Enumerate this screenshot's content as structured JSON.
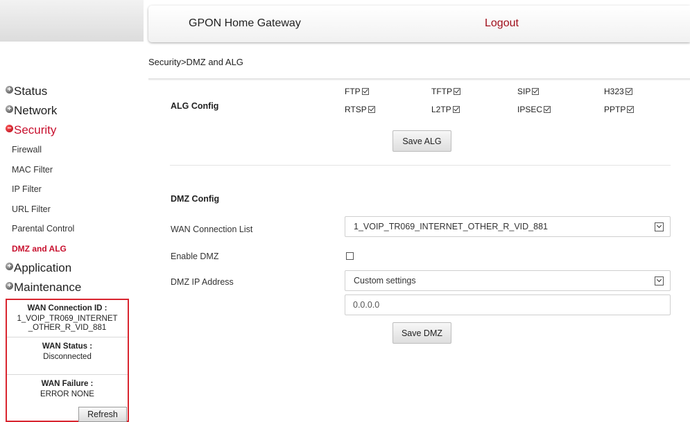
{
  "header": {
    "title": "GPON Home Gateway",
    "logout": "Logout"
  },
  "breadcrumb": "Security>DMZ and ALG",
  "nav": {
    "status": "Status",
    "network": "Network",
    "security": "Security",
    "security_sub": [
      "Firewall",
      "MAC Filter",
      "IP Filter",
      "URL Filter",
      "Parental Control",
      "DMZ and ALG"
    ],
    "application": "Application",
    "maintenance": "Maintenance"
  },
  "wan_info": {
    "conn_id_label": "WAN Connection ID :",
    "conn_id_value_line1": "1_VOIP_TR069_INTERNET",
    "conn_id_value_line2": "_OTHER_R_VID_881",
    "status_label": "WAN Status :",
    "status_value": "Disconnected",
    "failure_label": "WAN Failure :",
    "failure_value": "ERROR NONE",
    "refresh": "Refresh"
  },
  "alg": {
    "title": "ALG Config",
    "items": [
      {
        "label": "FTP",
        "checked": true
      },
      {
        "label": "TFTP",
        "checked": true
      },
      {
        "label": "SIP",
        "checked": true
      },
      {
        "label": "H323",
        "checked": true
      },
      {
        "label": "RTSP",
        "checked": true
      },
      {
        "label": "L2TP",
        "checked": true
      },
      {
        "label": "IPSEC",
        "checked": true
      },
      {
        "label": "PPTP",
        "checked": true
      }
    ],
    "save": "Save ALG"
  },
  "dmz": {
    "title": "DMZ Config",
    "wan_list_label": "WAN Connection List",
    "wan_list_value": "1_VOIP_TR069_INTERNET_OTHER_R_VID_881",
    "enable_label": "Enable DMZ",
    "enable_checked": false,
    "ip_label": "DMZ IP Address",
    "ip_mode_value": "Custom settings",
    "ip_value": "0.0.0.0",
    "save": "Save DMZ"
  }
}
